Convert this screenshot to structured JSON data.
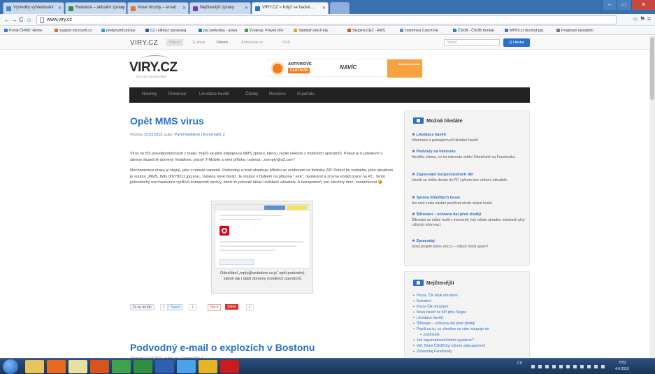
{
  "browser": {
    "tabs": [
      {
        "label": "Výsledky vyhledávání",
        "color": "#4a86d8"
      },
      {
        "label": "Redakce – aktuální zprávy",
        "color": "#3b8f3b"
      },
      {
        "label": "Nové hrozby – email",
        "color": "#e07a1e"
      },
      {
        "label": "Nejčtenější zprávy",
        "color": "#7a3bb0"
      },
      {
        "label": "VIRY.CZ » Když se hacké…",
        "color": "#2a6fc9"
      }
    ],
    "window_controls": {
      "minimize": "–",
      "maximize": "□",
      "close": "✕"
    },
    "url": "www.viry.cz",
    "bookmarks": [
      {
        "label": "Portál ČHMÚ: Home",
        "color": "#3a7bd5"
      },
      {
        "label": "support.microsoft.cz",
        "color": "#e06c1a"
      },
      {
        "label": "předpověď počasí",
        "color": "#2a9fd6"
      },
      {
        "label": "CZ | Hlídací zpravodaj",
        "color": "#1b5fb0"
      },
      {
        "label": "pej zemeztou - práva",
        "color": "#1e7fc8"
      },
      {
        "label": "Zvukový, Pravěk dřív",
        "color": "#3b9d3b"
      },
      {
        "label": "Slabikář všech kla.",
        "color": "#e8a31c"
      },
      {
        "label": "Skupina CEZ - RMS",
        "color": "#d8541a"
      },
      {
        "label": "Telefonica Czech Re.",
        "color": "#5b8fd4"
      },
      {
        "label": "ČSOB - ČSOB Kontak.",
        "color": "#2d7bd0"
      },
      {
        "label": "MPSV.cz duchod plá.",
        "color": "#3a78c4"
      },
      {
        "label": "Prognoze nestabilní.",
        "color": "#777777"
      }
    ]
  },
  "site": {
    "brand": "VIRY.CZ",
    "top_nav": [
      "Viry.cz",
      "E-shop",
      "Fórum",
      "Antivirové.cz",
      "RSS"
    ],
    "search_placeholder": "Hledat",
    "search_button": "Q Hledat",
    "logo": "VIRY.CZ",
    "logo_tagline": "VÍCE NEŽ JEN ANTIVIRUS",
    "banner": {
      "line1": "ANTIVIROVÉ",
      "line2": "CENTRUM",
      "tagline": "NAVÍC",
      "badge": "Jsme tu pro vás"
    },
    "main_nav": [
      "Novinky",
      "Prevence",
      "Likvidace havětí",
      "Články",
      "Recenze",
      "O portálu"
    ]
  },
  "post1": {
    "title": "Opět MMS virus",
    "meta_prefix": "Vloženo ",
    "date": "23.03.2013",
    "author_prefix": ", autor: ",
    "author": "Pavel Matějíček",
    "comments": "Komentářů: 2",
    "para1": "Virus ve 5/5 pravděpodobností z maku: hráčů se plně připojenou MMS zprávu, kterou zasíle některý z mobilních operátorů. Pokud je tu předevší v adrese skutečně domeny Vodafone, pozor! T-Mobile a není příloha i adresa: „noreply@o2.com\"",
    "para2": "Mechanismus útoku je stejný, jako v minulé variantě. Podvodný e-mail obsahuje přílohu se souborem ve formátu ZIP. Pokud ho rozbalíte, jeho obsahem je soubor „MMS_IMG 00278311.jpg.exe„. Vašena nové zkrátí. Je soubor s řádkem na přípona \".exe\", neotevírat a zrovna vznikli práce na PC. Tento jednoduchý mechanismus využívá kompromit zprávy, která se pokouší lákat i zvědavé uživatele. A nezapomeň, pro všechny mne, nesmírkovat 😀",
    "screenshot_caption": "Odesílatel „reply@vodafone.cz.js\" opět podvodný, stejně tak i další domény mobilních operátorů."
  },
  "share": {
    "facebook": "To se mi líbí",
    "facebook_count": "1",
    "twitter": "Tweet",
    "twitter_count": "1",
    "gplus": "Pin it",
    "reddit": "Sdílet",
    "reddit_count": "1"
  },
  "post2": {
    "title": "Podvodný e-mail o explozích v Bostonu",
    "meta": "Vloženo 17.04.2013, autor: ve | Komentářů: 0"
  },
  "sidebar": {
    "might_find": {
      "title": "Možná hledáte",
      "items": [
        {
          "title": "Likvidace havětí",
          "desc": "Informace o postupech při likvidaci havětí"
        },
        {
          "title": "Podvody na internetu",
          "desc": "Nevěřte všemu, co na internetu vidíte! Obezřetně na Facebooku."
        },
        {
          "title": "Zapisování bezpečnostních děr",
          "desc": "Havětí se může dostat do PC i přesto bez vědomí uživatele."
        },
        {
          "title": "Správa důležitých hesel",
          "desc": "Asi není zcela ideální používat všude stejné heslo."
        },
        {
          "title": "Šifrování – ochrana dat před zlodějí",
          "desc": "Šifrování se může hodit v momentě, kdy někdo ukradne notebook plný citlivých informací."
        },
        {
          "title": "Zpravodaj",
          "desc": "Nový projekt webu viry.cz – odkud chodí spam?"
        }
      ]
    },
    "most_read": {
      "title": "Nejčtenější",
      "items": [
        "Pozor, ČR stále ohrožení",
        "Nulodení",
        "Pozor ČR ohrožení",
        "Nová havěť se šíří přes Skype",
        "Likvidace havětí",
        "Šifrování – ochrana dat před zlodějí",
        "Popíš na tu, co všechno se vám vstupuje do",
        "pozůstalá",
        "Jak zapamatovat hodně vypálené?",
        "Věř. Bráni ČSOB byl účinné zabezpečení!",
        "Zpravodaj Facebooky"
      ]
    }
  },
  "taskbar": {
    "apps": [
      {
        "name": "explorer",
        "color": "#e8c25a"
      },
      {
        "name": "media",
        "color": "#e86a1c"
      },
      {
        "name": "outlook",
        "color": "#e8e0a0"
      },
      {
        "name": "powerpoint",
        "color": "#d8541a"
      },
      {
        "name": "green-app",
        "color": "#3fa34d"
      },
      {
        "name": "excel",
        "color": "#2f8f3f"
      },
      {
        "name": "word",
        "color": "#2f5fb0"
      },
      {
        "name": "ie",
        "color": "#4aa3e8"
      },
      {
        "name": "chrome",
        "color": "#e8b420"
      },
      {
        "name": "acrobat",
        "color": "#c91d1d"
      }
    ],
    "language": "CS",
    "time": "8:52",
    "date": "4.4.2013"
  }
}
